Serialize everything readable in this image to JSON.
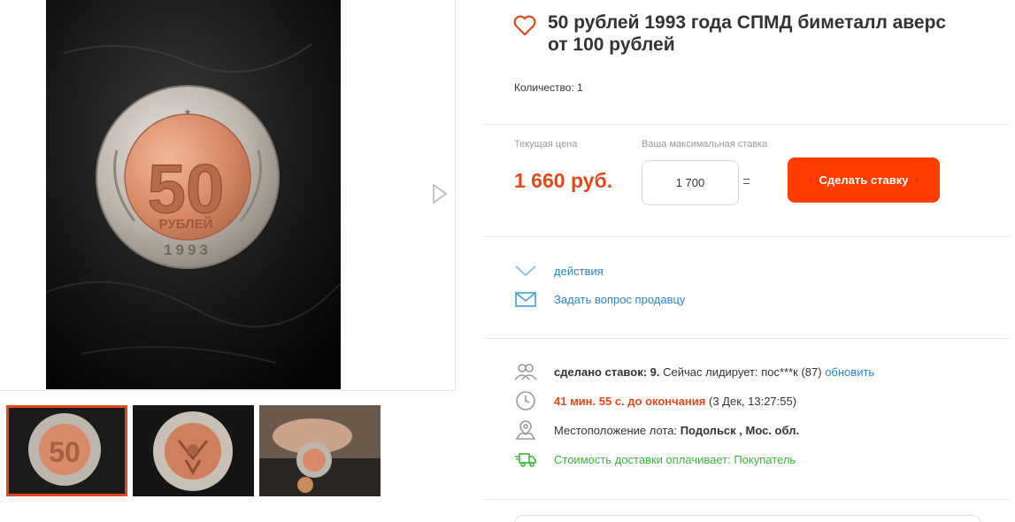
{
  "lot": {
    "title": "50 рублей 1993 года СПМД биметалл аверс от 100 рублей",
    "quantity_label": "Количество:",
    "quantity_value": "1"
  },
  "gallery": {
    "main_coin": {
      "denomination": "50",
      "word": "РУБЛЕЙ",
      "year": "1993"
    },
    "thumbnail_count": 3,
    "active_thumbnail": 1
  },
  "pricing": {
    "current_price_label": "Текущая цена",
    "current_price": "1 660 руб.",
    "max_bid_label": "Ваша максимальная ставка",
    "max_bid_value": "1 700",
    "bid_button_label": "Сделать ставку",
    "accent_color": "#ff3d00"
  },
  "actions": {
    "actions_label": "действия",
    "ask_seller_label": "Задать вопрос продавцу"
  },
  "info": {
    "bids_label": "сделано ставок: 9.",
    "leader_text": "Сейчас лидирует: пос***к (87)",
    "refresh_label": "обновить",
    "time_left": "41 мин. 55 с. до окончания",
    "end_date": "(3 Дек, 13:27:55)",
    "location_label": "Местоположение лота:",
    "location_value": "Подольск , Мос. обл.",
    "delivery_text": "Стоимость доставки оплачивает: Покупатель"
  },
  "icons": [
    "expand-icon",
    "next-arrow-icon",
    "heart-icon",
    "chevron-down-icon",
    "envelope-icon",
    "users-icon",
    "clock-icon",
    "location-pin-icon",
    "delivery-truck-icon"
  ]
}
